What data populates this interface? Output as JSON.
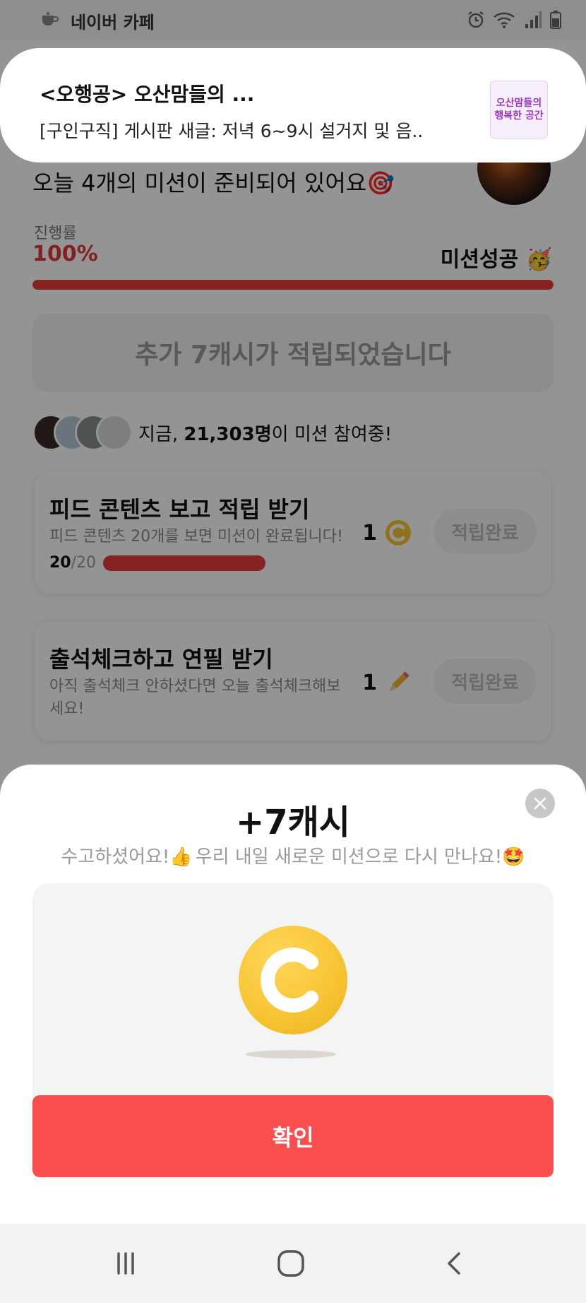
{
  "status_bar": {
    "app_name": "네이버 카페",
    "icons": [
      "alarm-icon",
      "wifi-icon",
      "signal-icon",
      "battery-icon"
    ]
  },
  "notification": {
    "title": "<오행공> 오산맘들의 ...",
    "body": "[구인구직] 게시판 새글: 저녁 6~9시 설거지 및 음..",
    "thumbnail_text": "오산맘들의 행복한 공간"
  },
  "mission": {
    "headline": "오늘 4개의 미션이 준비되어 있어요🎯",
    "progress_label": "진행률",
    "progress_value": "100%",
    "progress_fraction": 1.0,
    "success_label": "미션성공 🥳",
    "extra_banner": "추가 7캐시가 적립되었습니다",
    "participants_prefix": "지금, ",
    "participants_count": "21,303명",
    "participants_suffix": "이 미션 참여중!"
  },
  "tasks": [
    {
      "title": "피드 콘텐츠 보고 적립 받기",
      "desc": "피드 콘텐츠 20개를 보면 미션이 완료됩니다!",
      "progress_done": "20",
      "progress_total": "/20",
      "reward_amount": "1",
      "reward_icon": "cash-coin-icon",
      "button_label": "적립완료"
    },
    {
      "title": "출석체크하고 연필 받기",
      "desc": "아직 출석체크 안하셨다면 오늘 출석체크해보세요!",
      "reward_amount": "1",
      "reward_icon": "pencil-icon",
      "button_label": "적립완료"
    }
  ],
  "sheet": {
    "title": "+7캐시",
    "subtitle_start": "수고하셨어요!👍 ",
    "subtitle_end": "우리 내일 새로운 미션으로 다시 만나요!🤩",
    "confirm_label": "확인"
  },
  "nav": [
    "recent-apps-icon",
    "home-icon",
    "back-icon"
  ],
  "colors": {
    "accent_red": "#fb4f4f",
    "progress_red": "#e53b3b",
    "coin_yellow": "#f8c536"
  }
}
